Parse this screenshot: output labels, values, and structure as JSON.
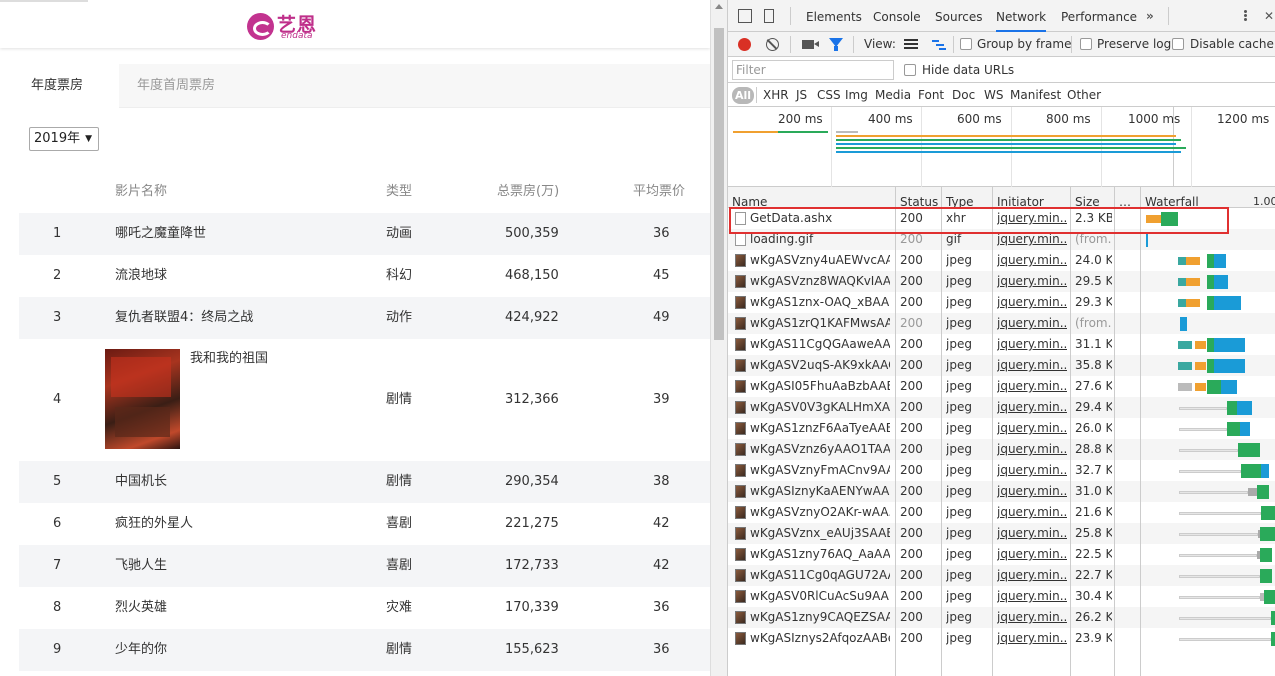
{
  "logo": {
    "cn": "艺恩",
    "en": "endata"
  },
  "tabs": [
    "年度票房",
    "年度首周票房"
  ],
  "year_select": {
    "value": "2019年"
  },
  "table": {
    "headers": {
      "name": "影片名称",
      "type": "类型",
      "box": "总票房(万)",
      "avg": "平均票价"
    },
    "rows": [
      {
        "rank": "1",
        "name": "哪吒之魔童降世",
        "type": "动画",
        "box": "500,359",
        "avg": "36"
      },
      {
        "rank": "2",
        "name": "流浪地球",
        "type": "科幻",
        "box": "468,150",
        "avg": "45"
      },
      {
        "rank": "3",
        "name": "复仇者联盟4：终局之战",
        "type": "动作",
        "box": "424,922",
        "avg": "49"
      },
      {
        "rank": "4",
        "name": "我和我的祖国",
        "type": "剧情",
        "box": "312,366",
        "avg": "39"
      },
      {
        "rank": "5",
        "name": "中国机长",
        "type": "剧情",
        "box": "290,354",
        "avg": "38"
      },
      {
        "rank": "6",
        "name": "疯狂的外星人",
        "type": "喜剧",
        "box": "221,275",
        "avg": "42"
      },
      {
        "rank": "7",
        "name": "飞驰人生",
        "type": "喜剧",
        "box": "172,733",
        "avg": "42"
      },
      {
        "rank": "8",
        "name": "烈火英雄",
        "type": "灾难",
        "box": "170,339",
        "avg": "36"
      },
      {
        "rank": "9",
        "name": "少年的你",
        "type": "剧情",
        "box": "155,623",
        "avg": "36"
      }
    ]
  },
  "devtools": {
    "tabs": [
      "Elements",
      "Console",
      "Sources",
      "Network",
      "Performance"
    ],
    "active_tab": "Network",
    "more": "»",
    "close": "✕",
    "toolbar": {
      "view_label": "View:",
      "group_by_frame": "Group by frame",
      "preserve_log": "Preserve log",
      "disable_cache": "Disable cache"
    },
    "filter": {
      "placeholder": "Filter",
      "hide_data_urls": "Hide data URLs"
    },
    "types": [
      "All",
      "XHR",
      "JS",
      "CSS",
      "Img",
      "Media",
      "Font",
      "Doc",
      "WS",
      "Manifest",
      "Other"
    ],
    "overview_ticks": [
      "200 ms",
      "400 ms",
      "600 ms",
      "800 ms",
      "1000 ms",
      "1200 ms"
    ],
    "columns": {
      "name": "Name",
      "status": "Status",
      "type": "Type",
      "initiator": "Initiator",
      "size": "Size",
      "dots": "…",
      "waterfall": "Waterfall",
      "wf_tick": "1.00"
    },
    "requests": [
      {
        "name": "GetData.ashx",
        "status": "200",
        "type": "xhr",
        "initiator": "jquery.min....",
        "size": "2.3 KB",
        "icon": "document-icon"
      },
      {
        "name": "loading.gif",
        "status": "200",
        "type": "gif",
        "initiator": "jquery.min....",
        "size": "(from...",
        "icon": "document-icon"
      },
      {
        "name": "wKgASVzny4uAEWvcAA...",
        "status": "200",
        "type": "jpeg",
        "initiator": "jquery.min....",
        "size": "24.0 KB",
        "icon": "image-icon"
      },
      {
        "name": "wKgASVznz8WAQKvIAA...",
        "status": "200",
        "type": "jpeg",
        "initiator": "jquery.min....",
        "size": "29.5 KB",
        "icon": "image-icon"
      },
      {
        "name": "wKgAS1znx-OAQ_xBAA...",
        "status": "200",
        "type": "jpeg",
        "initiator": "jquery.min....",
        "size": "29.3 KB",
        "icon": "image-icon"
      },
      {
        "name": "wKgAS1zrQ1KAFMwsAA...",
        "status": "200",
        "type": "jpeg",
        "initiator": "jquery.min....",
        "size": "(from...",
        "icon": "image-icon"
      },
      {
        "name": "wKgAS11CgQGAaweAA...",
        "status": "200",
        "type": "jpeg",
        "initiator": "jquery.min....",
        "size": "31.1 KB",
        "icon": "image-icon"
      },
      {
        "name": "wKgASV2uqS-AK9xkAAC...",
        "status": "200",
        "type": "jpeg",
        "initiator": "jquery.min....",
        "size": "35.8 KB",
        "icon": "image-icon"
      },
      {
        "name": "wKgASI05FhuAaBzbAAB...",
        "status": "200",
        "type": "jpeg",
        "initiator": "jquery.min....",
        "size": "27.6 KB",
        "icon": "image-icon"
      },
      {
        "name": "wKgASV0V3gKALHmXA...",
        "status": "200",
        "type": "jpeg",
        "initiator": "jquery.min....",
        "size": "29.4 KB",
        "icon": "image-icon"
      },
      {
        "name": "wKgAS1znzF6AaTyeAAB...",
        "status": "200",
        "type": "jpeg",
        "initiator": "jquery.min....",
        "size": "26.0 KB",
        "icon": "image-icon"
      },
      {
        "name": "wKgASVznz6yAAO1TAA...",
        "status": "200",
        "type": "jpeg",
        "initiator": "jquery.min....",
        "size": "28.8 KB",
        "icon": "image-icon"
      },
      {
        "name": "wKgASVznyFmACnv9AA...",
        "status": "200",
        "type": "jpeg",
        "initiator": "jquery.min....",
        "size": "32.7 KB",
        "icon": "image-icon"
      },
      {
        "name": "wKgASIznyKaAENYwAA...",
        "status": "200",
        "type": "jpeg",
        "initiator": "jquery.min....",
        "size": "31.0 KB",
        "icon": "image-icon"
      },
      {
        "name": "wKgASVznyO2AKr-wAA...",
        "status": "200",
        "type": "jpeg",
        "initiator": "jquery.min....",
        "size": "21.6 KB",
        "icon": "image-icon"
      },
      {
        "name": "wKgASVznx_eAUj3SAAB...",
        "status": "200",
        "type": "jpeg",
        "initiator": "jquery.min....",
        "size": "25.8 KB",
        "icon": "image-icon"
      },
      {
        "name": "wKgAS1zny76AQ_AaAA...",
        "status": "200",
        "type": "jpeg",
        "initiator": "jquery.min....",
        "size": "22.5 KB",
        "icon": "image-icon"
      },
      {
        "name": "wKgAS11Cg0qAGU72AA...",
        "status": "200",
        "type": "jpeg",
        "initiator": "jquery.min....",
        "size": "22.7 KB",
        "icon": "image-icon"
      },
      {
        "name": "wKgASV0RlCuAcSu9AAB...",
        "status": "200",
        "type": "jpeg",
        "initiator": "jquery.min....",
        "size": "30.4 KB",
        "icon": "image-icon"
      },
      {
        "name": "wKgAS1zny9CAQEZSAA...",
        "status": "200",
        "type": "jpeg",
        "initiator": "jquery.min....",
        "size": "26.2 KB",
        "icon": "image-icon"
      },
      {
        "name": "wKgASIznys2AfqozAABe...",
        "status": "200",
        "type": "jpeg",
        "initiator": "jquery.min....",
        "size": "23.9 KB",
        "icon": "image-icon"
      }
    ]
  },
  "colors": {
    "brand": "#bf2f8a",
    "record": "#d93025",
    "accent": "#1a73e8",
    "highlight": "#e03030"
  }
}
